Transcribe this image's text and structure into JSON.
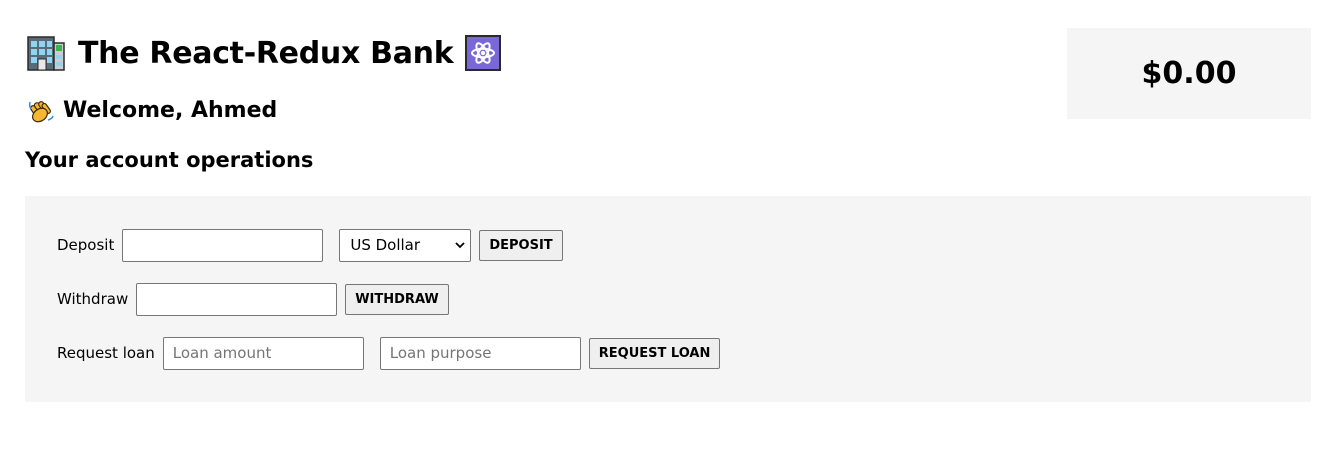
{
  "header": {
    "title": "The React-Redux Bank",
    "title_icon_left": "bank-building-icon",
    "title_icon_right": "atom-icon",
    "welcome": "Welcome, Ahmed",
    "welcome_icon": "waving-hand-icon"
  },
  "balance": {
    "amount": "$0.00"
  },
  "operations": {
    "heading": "Your account operations",
    "deposit": {
      "label": "Deposit",
      "amount_value": "",
      "currency_selected": "US Dollar",
      "button": "DEPOSIT"
    },
    "withdraw": {
      "label": "Withdraw",
      "amount_value": "",
      "button": "WITHDRAW"
    },
    "loan": {
      "label": "Request loan",
      "amount_placeholder": "Loan amount",
      "purpose_placeholder": "Loan purpose",
      "button": "REQUEST LOAN"
    }
  },
  "colors": {
    "panel_bg": "#f5f5f5",
    "atom_bg": "#7b68d8",
    "button_bg": "#efefef"
  }
}
